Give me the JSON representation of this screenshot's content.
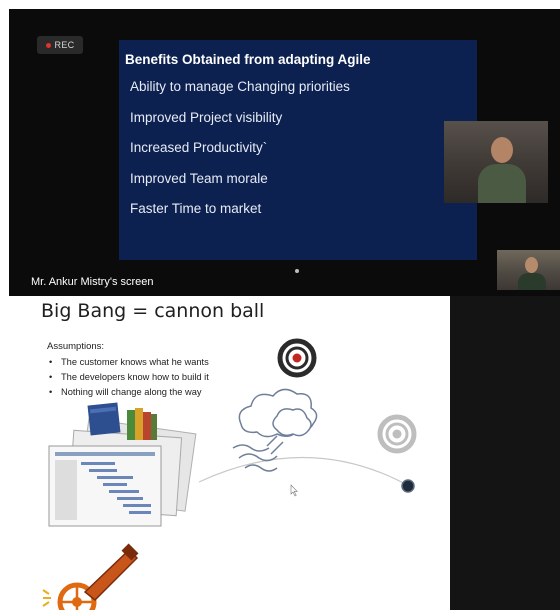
{
  "recording": {
    "label": "REC",
    "dot_color": "#e0332a"
  },
  "shared_slide": {
    "title": "Benefits Obtained from adapting Agile",
    "items": [
      "Ability to manage Changing priorities",
      "Improved Project visibility",
      "Increased Productivity`",
      "Improved Team morale",
      "Faster Time to market"
    ],
    "background_color": "#0d2150"
  },
  "screen_share_label": "Mr. Ankur Mistry's screen",
  "second_slide": {
    "title": "Big Bang = cannon ball",
    "assumptions_title": "Assumptions:",
    "bullet": "•",
    "assumptions": [
      "The customer knows what he wants",
      "The developers know how to build it",
      "Nothing will change along the way"
    ]
  },
  "participant_tiles": [
    {
      "icon": "participant-video-icon"
    },
    {
      "icon": "participant-video-icon"
    }
  ]
}
